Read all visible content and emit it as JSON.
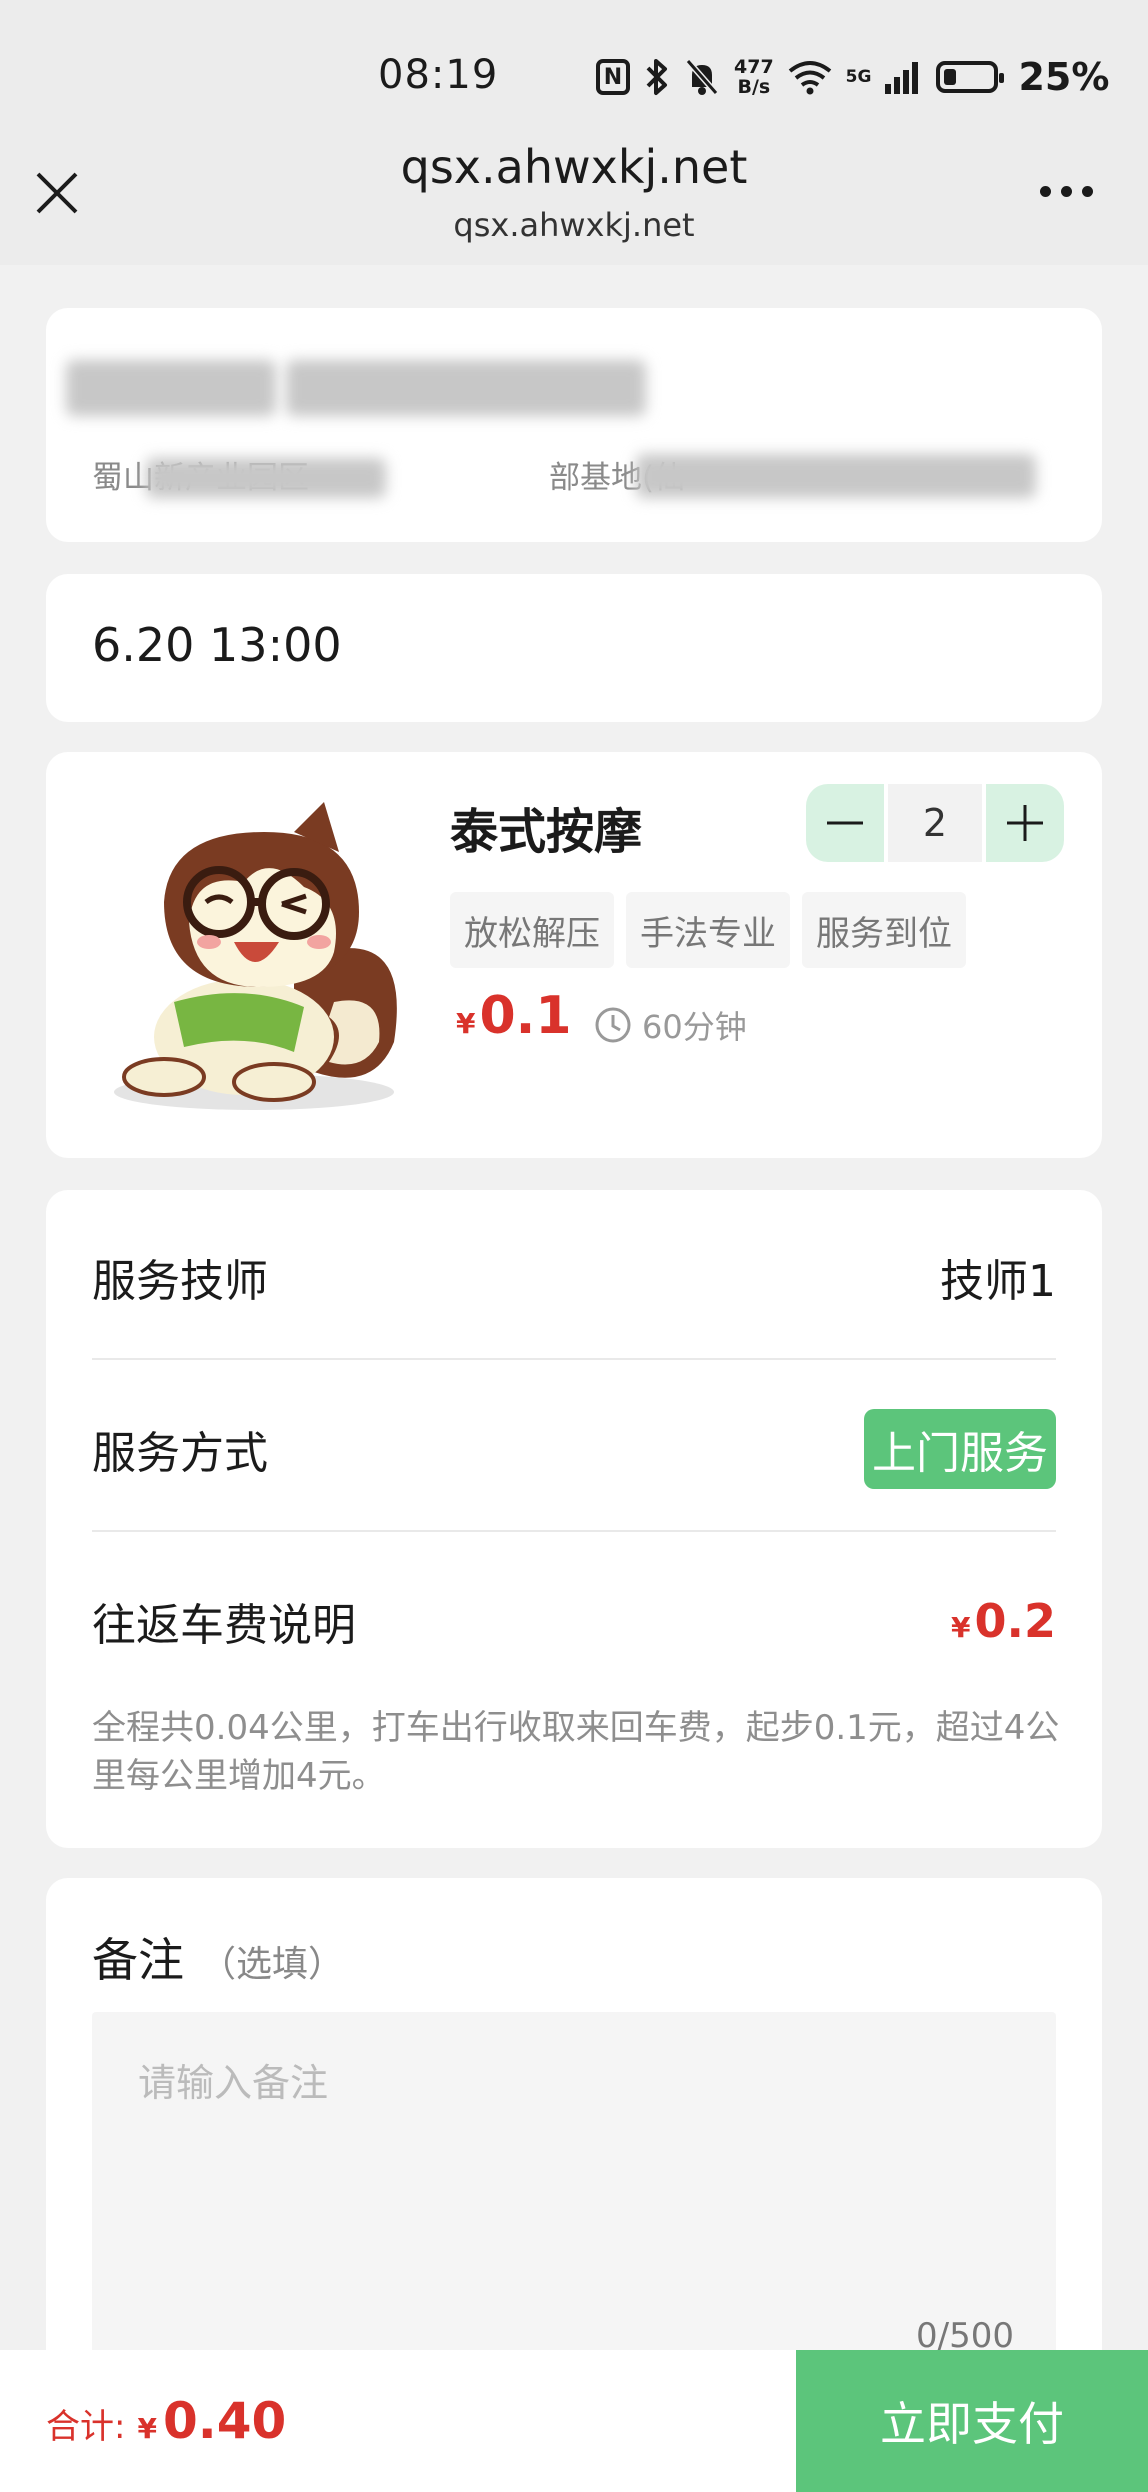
{
  "status_bar": {
    "time": "08:19",
    "nfc_label": "N",
    "net_speed_top": "477",
    "net_speed_bottom": "B/s",
    "network_type": "5G",
    "battery_level": 0.25,
    "battery_text": "25%"
  },
  "browser": {
    "title": "qsx.ahwxkj.net",
    "url": "qsx.ahwxkj.net"
  },
  "address": {
    "address_visible_start": "蜀山新产业园区",
    "address_visible_mid": "部基地(仙"
  },
  "booking": {
    "time": "6.20 13:00"
  },
  "service": {
    "name": "泰式按摩",
    "quantity": "2",
    "tags": [
      "放松解压",
      "手法专业",
      "服务到位"
    ],
    "currency": "¥",
    "price": "0.1",
    "duration": "60分钟"
  },
  "details": {
    "technician_label": "服务技师",
    "technician_value": "技师1",
    "mode_label": "服务方式",
    "mode_value": "上门服务",
    "fee_label": "往返车费说明",
    "fee_currency": "¥",
    "fee_value": "0.2",
    "fee_note": "全程共0.04公里，打车出行收取来回车费，起步0.1元，超过4公里每公里增加4元。"
  },
  "remark": {
    "title": "备注",
    "optional": "（选填）",
    "placeholder": "请输入备注",
    "counter": "0/500"
  },
  "footer": {
    "total_label": "合计:",
    "total_currency": "¥",
    "total_amount": "0.40",
    "pay_button": "立即支付"
  },
  "colors": {
    "accent_green": "#5cc57b",
    "stepper_green": "#d8f2e2",
    "price_red": "#d9322b"
  }
}
